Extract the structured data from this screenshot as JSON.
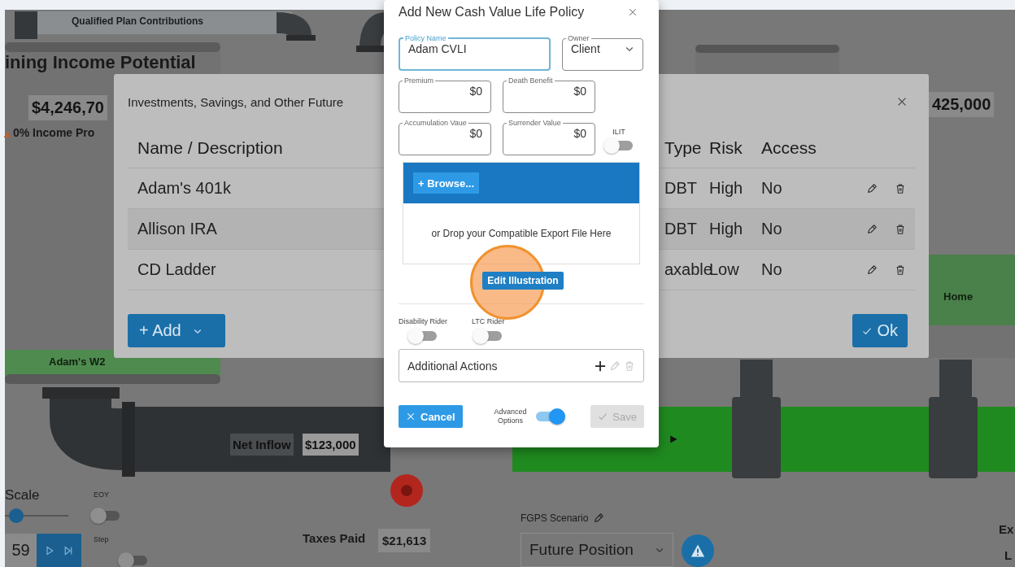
{
  "background": {
    "pipe_label": "Qualified Plan Contributions",
    "income_panel": {
      "title": "ining Income Potential",
      "amount": "$4,246,70",
      "note": "0% Income Pro"
    },
    "right_amount": "425,000",
    "w2_label": "Adam's W2",
    "home_label": "Home",
    "net_inflow": {
      "label": "Net Inflow",
      "value": "$123,000"
    },
    "taxes_paid": {
      "label": "Taxes Paid",
      "value": "$21,613"
    },
    "controls": {
      "scale_label": "Scale",
      "scale": {
        "level": 0.08
      },
      "year": "59",
      "eoy": {
        "label": "EOY",
        "on": false
      },
      "step": {
        "label": "Step",
        "on": false
      }
    },
    "scenario": {
      "label": "FGPS Scenario",
      "value": "Future Position"
    },
    "edge_texts": [
      "Ex",
      "L"
    ]
  },
  "investments_dialog": {
    "title": "Investments, Savings, and Other Future",
    "columns": [
      "Name / Description",
      "Type",
      "Risk",
      "Access"
    ],
    "rows": [
      {
        "name": "Adam's 401k",
        "type": "DBT",
        "risk": "High",
        "access": "No"
      },
      {
        "name": "Allison IRA",
        "type": "DBT",
        "risk": "High",
        "access": "No"
      },
      {
        "name": "CD Ladder",
        "type": "axable",
        "risk": "Low",
        "access": "No"
      }
    ],
    "add_button": "+ Add",
    "ok_button": "Ok"
  },
  "policy_dialog": {
    "title": "Add New Cash Value Life Policy",
    "fields": [
      {
        "label": "Policy Name",
        "value": "Adam CVLI",
        "kind": "text",
        "focused": true
      },
      {
        "label": "Owner",
        "value": "Client",
        "kind": "select",
        "focused": false
      },
      {
        "label": "Premium",
        "value": "$0",
        "kind": "money",
        "focused": false
      },
      {
        "label": "Death Benefit",
        "value": "$0",
        "kind": "money",
        "focused": false
      },
      {
        "label": "Accumulation Vaue",
        "value": "$0",
        "kind": "money",
        "focused": false
      },
      {
        "label": "Surrender Value",
        "value": "$0",
        "kind": "money",
        "focused": false
      }
    ],
    "ilit": {
      "label": "ILIT",
      "on": false
    },
    "upload": {
      "browse": "+ Browse...",
      "drop_text": "or Drop your Compatible Export File Here"
    },
    "edit_button": "Edit Illustration",
    "riders": [
      {
        "label": "Disability Rider",
        "on": false
      },
      {
        "label": "LTC Rider",
        "on": false
      }
    ],
    "additional_actions": "Additional Actions",
    "cancel": {
      "label": "Cancel",
      "disabled": false
    },
    "advanced": {
      "label": "Advanced Options",
      "on": true
    },
    "save": {
      "label": "Save",
      "disabled": true
    }
  }
}
